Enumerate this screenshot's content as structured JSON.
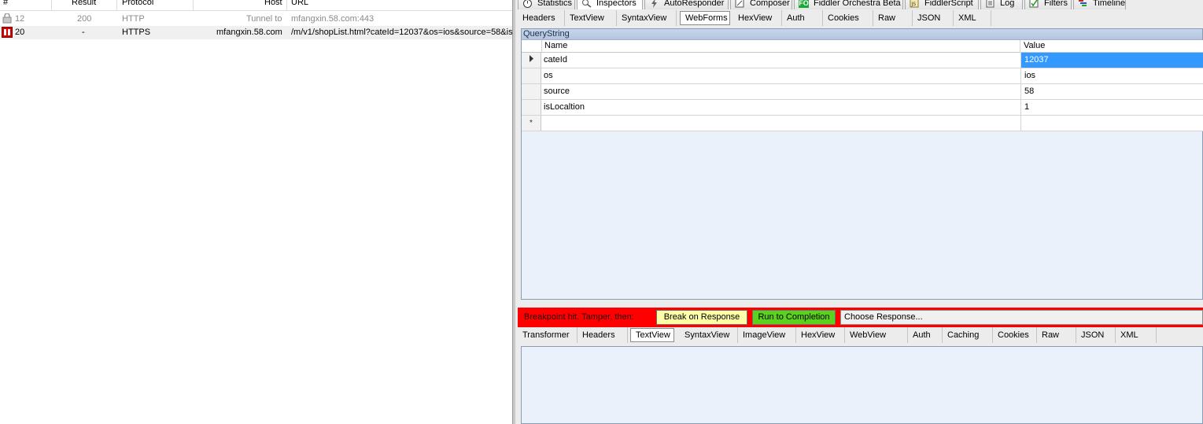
{
  "session_list": {
    "columns": [
      "#",
      "Result",
      "Protocol",
      "Host",
      "URL"
    ],
    "rows": [
      {
        "id": "12",
        "result": "200",
        "protocol": "HTTP",
        "host": "Tunnel to",
        "url": "mfangxin.58.com:443",
        "icon": "lock-icon"
      },
      {
        "id": "20",
        "result": "-",
        "protocol": "HTTPS",
        "host": "mfangxin.58.com",
        "url": "/m/v1/shopList.html?cateId=12037&os=ios&source=58&is",
        "icon": "breakpoint-icon"
      }
    ]
  },
  "main_tabs": [
    {
      "label": "Statistics",
      "icon": "stopwatch-icon"
    },
    {
      "label": "Inspectors",
      "icon": "inspect-icon"
    },
    {
      "label": "AutoResponder",
      "icon": "lightning-icon"
    },
    {
      "label": "Composer",
      "icon": "pencil-icon"
    },
    {
      "label": "Fiddler Orchestra Beta",
      "icon": "fo-icon"
    },
    {
      "label": "FiddlerScript",
      "icon": "script-icon"
    },
    {
      "label": "Log",
      "icon": "log-icon"
    },
    {
      "label": "Filters",
      "icon": "checkbox-icon"
    },
    {
      "label": "Timeline",
      "icon": "timeline-icon"
    }
  ],
  "request_tabs": [
    "Headers",
    "TextView",
    "SyntaxView",
    "WebForms",
    "HexView",
    "Auth",
    "Cookies",
    "Raw",
    "JSON",
    "XML"
  ],
  "request_active_tab": "WebForms",
  "querystring": {
    "title": "QueryString",
    "name_header": "Name",
    "value_header": "Value",
    "rows": [
      {
        "name": "cateId",
        "value": "12037"
      },
      {
        "name": "os",
        "value": "ios"
      },
      {
        "name": "source",
        "value": "58"
      },
      {
        "name": "isLocaltion",
        "value": "1"
      }
    ],
    "new_row_marker": "*"
  },
  "breakpoint": {
    "message": "Breakpoint hit. Tamper, then:",
    "break_on_response": "Break on Response",
    "run_to_completion": "Run to Completion",
    "choose_response": "Choose Response..."
  },
  "response_tabs": [
    "Transformer",
    "Headers",
    "TextView",
    "SyntaxView",
    "ImageView",
    "HexView",
    "WebView",
    "Auth",
    "Caching",
    "Cookies",
    "Raw",
    "JSON",
    "XML"
  ],
  "response_active_tab": "TextView",
  "colors": {
    "breakpoint_bar": "#ff0000",
    "selected_value": "#3399ff",
    "break_button": "#ffffa8",
    "run_button": "#5bd21e"
  }
}
